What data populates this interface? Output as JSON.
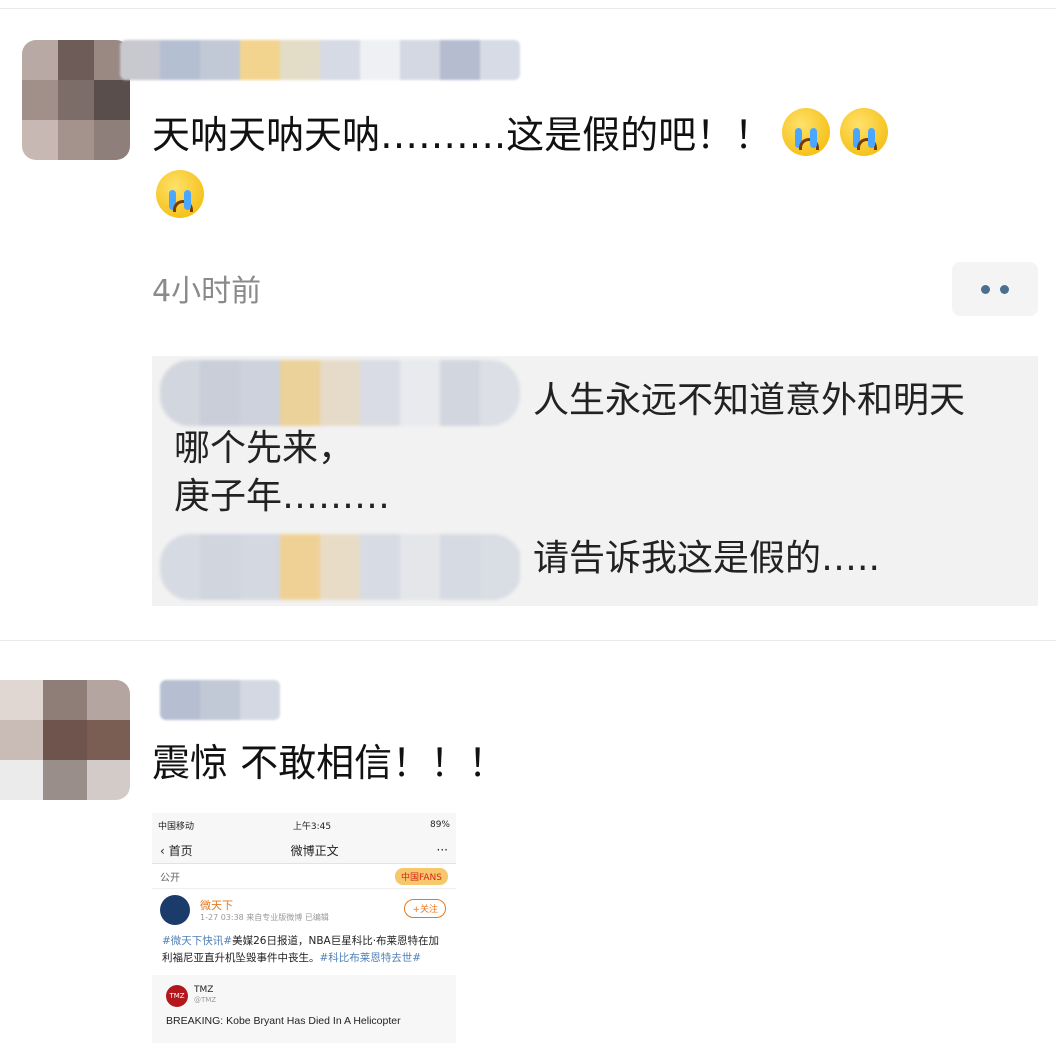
{
  "comment1": {
    "text": "天呐天呐天呐……….这是假的吧！！",
    "emojis": [
      "crying-face",
      "crying-face",
      "crying-face"
    ],
    "time": "4小时前",
    "replies": [
      {
        "text_line1": "人生永远不知道意外和明天",
        "text_line2": "哪个先来，",
        "text_line3": "庚子年………"
      },
      {
        "text": "请告诉我这是假的….."
      }
    ]
  },
  "comment2": {
    "text": "震惊   不敢相信！！！",
    "screenshot": {
      "carrier": "中国移动",
      "time": "上午3:45",
      "battery": "89%",
      "back_label": "首页",
      "nav_title": "微博正文",
      "nav_more": "···",
      "visibility": "公开",
      "badge_text": "中国FANS",
      "author": "微天下",
      "meta": "1-27 03:38  来自专业版微博  已编辑",
      "follow_label": "+关注",
      "body_tag": "#微天下快讯#",
      "body_text": "美媒26日报道，NBA巨星科比·布莱恩特在加利福尼亚直升机坠毁事件中丧生。",
      "body_tag2": "#科比布莱恩特去世#",
      "quote_logo": "TMZ",
      "quote_name": "TMZ",
      "quote_handle": "@TMZ",
      "quote_text": "BREAKING: Kobe Bryant Has Died In A Helicopter"
    }
  },
  "colors": {
    "link": "#4a6f8f",
    "reply_bg": "#f2f2f2",
    "timestamp": "#8a8a8a",
    "accent": "#e5781f"
  }
}
